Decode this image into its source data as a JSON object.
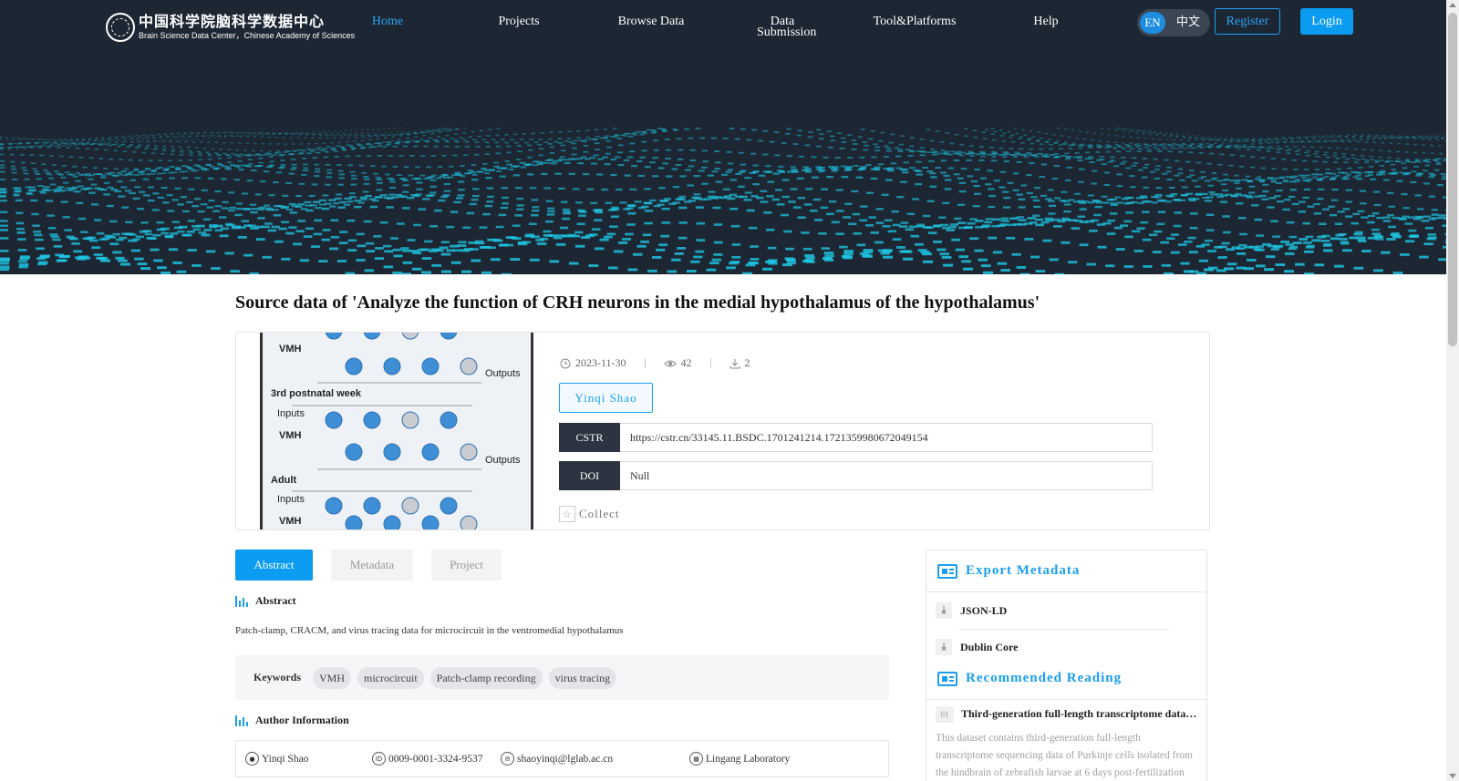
{
  "header": {
    "logo_cn": "中国科学院脑科学数据中心",
    "logo_en": "Brain Science Data Center，Chinese Academy of Sciences",
    "nav": [
      {
        "label": "Home",
        "active": true
      },
      {
        "label": "Projects",
        "active": false
      },
      {
        "label": "Browse Data",
        "active": false
      },
      {
        "label": "Data Submission",
        "active": false
      },
      {
        "label": "Tool&Platforms",
        "active": false
      },
      {
        "label": "Help",
        "active": false
      }
    ],
    "lang_en": "EN",
    "lang_zh": "中文",
    "register": "Register",
    "login": "Login"
  },
  "dataset": {
    "title": "Source data of 'Analyze the function of CRH neurons in the medial hypothalamus of the hypothalamus'",
    "date": "2023-11-30",
    "views": "42",
    "downloads": "2",
    "author_chip": "Yinqi Shao",
    "cstr_label": "CSTR",
    "cstr_value": "https://cstr.cn/33145.11.BSDC.1701241214.1721359980672049154",
    "doi_label": "DOI",
    "doi_value": "Null",
    "collect": "Collect"
  },
  "figure": {
    "labels": [
      "VMH",
      "Outputs",
      "3rd postnatal week",
      "Inputs",
      "VMH",
      "Outputs",
      "Adult",
      "Inputs",
      "VMH"
    ]
  },
  "tabs": [
    {
      "label": "Abstract",
      "active": true
    },
    {
      "label": "Metadata",
      "active": false
    },
    {
      "label": "Project",
      "active": false
    }
  ],
  "abstract": {
    "heading": "Abstract",
    "text": "Patch-clamp, CRACM, and virus tracing data for microcircuit in the ventromedial hypothalamus"
  },
  "keywords": {
    "label": "Keywords",
    "items": [
      "VMH",
      "microcircuit",
      "Patch-clamp recording",
      "virus tracing"
    ]
  },
  "author_info": {
    "heading": "Author Information",
    "name": "Yinqi Shao",
    "orcid": "0009-0001-3324-9537",
    "email": "shaoyinqi@lglab.ac.cn",
    "org": "Lingang Laboratory"
  },
  "export": {
    "heading": "Export Metadata",
    "items": [
      "JSON-LD",
      "Dublin Core"
    ]
  },
  "recommended": {
    "heading": "Recommended Reading",
    "items": [
      {
        "num": "01",
        "title": "Third-generation full-length transcriptome datasets of Purkinje cells",
        "desc": "This dataset contains third-generation full-length transcriptome sequencing data of Purkinje cells isolated from the hindbrain of zebrafish larvae at 6 days post-fertilization"
      }
    ]
  },
  "colors": {
    "accent": "#0b9cf2",
    "header_bg": "#1d2733",
    "wave": "#1ec8e6"
  }
}
